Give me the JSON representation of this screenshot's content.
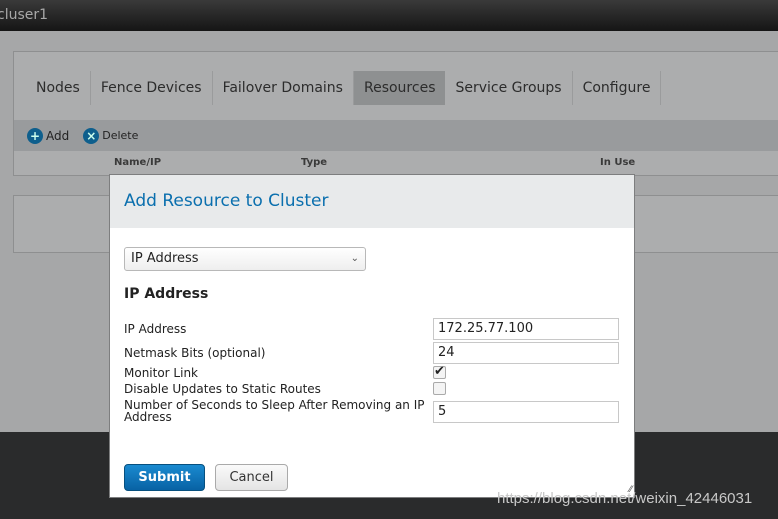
{
  "window": {
    "title": "cluser1"
  },
  "tabs": [
    {
      "label": "Nodes"
    },
    {
      "label": "Fence Devices"
    },
    {
      "label": "Failover Domains"
    },
    {
      "label": "Resources"
    },
    {
      "label": "Service Groups"
    },
    {
      "label": "Configure"
    }
  ],
  "active_tab": "Resources",
  "toolbar": {
    "add": "Add",
    "delete": "Delete"
  },
  "columns": [
    "Name/IP",
    "Type",
    "In Use"
  ],
  "dialog": {
    "title": "Add Resource to Cluster",
    "resource_type": "IP Address",
    "section": "IP Address",
    "fields": {
      "ip_label": "IP Address",
      "ip_value": "172.25.77.100",
      "netmask_label": "Netmask Bits (optional)",
      "netmask_value": "24",
      "monitor_label": "Monitor Link",
      "monitor_checked": true,
      "disable_label": "Disable Updates to Static Routes",
      "disable_checked": false,
      "sleep_label": "Number of Seconds to Sleep After Removing an IP Address",
      "sleep_value": "5"
    },
    "submit": "Submit",
    "cancel": "Cancel"
  },
  "watermark": "https://blog.csdn.net/weixin_42446031"
}
